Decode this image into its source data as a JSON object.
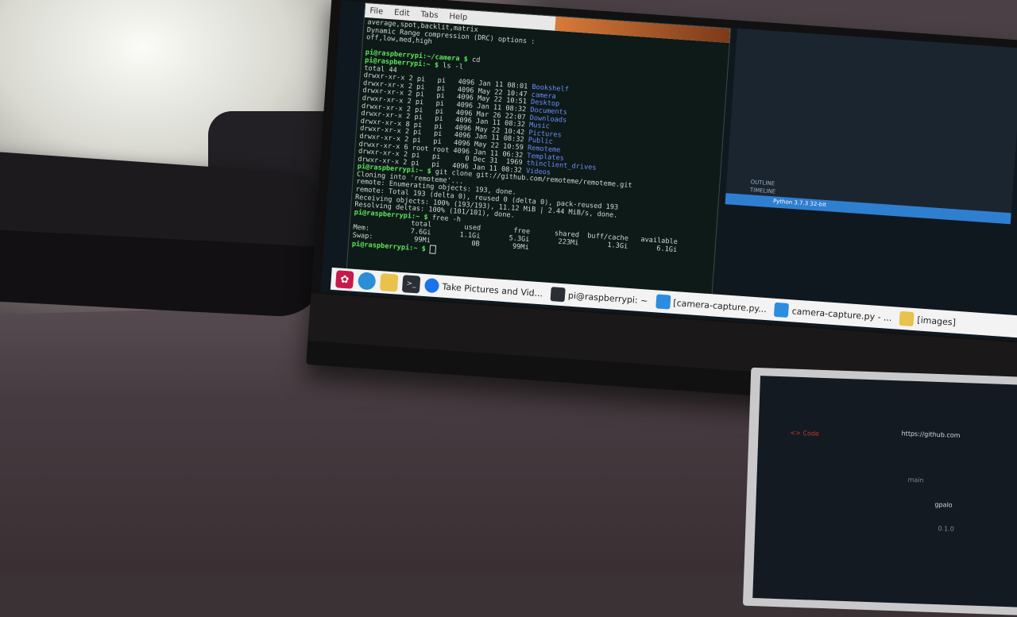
{
  "terminal": {
    "menu": [
      "File",
      "Edit",
      "Tabs",
      "Help"
    ],
    "lines": [
      {
        "t": "average,spot,backlit,matrix",
        "c": ""
      },
      {
        "t": "Dynamic Range compression (DRC) options :",
        "c": ""
      },
      {
        "t": "off,low,med,high",
        "c": ""
      },
      {
        "t": "",
        "c": ""
      },
      {
        "p": "pi@raspberrypi:~/camera $ ",
        "t": "cd",
        "c": ""
      },
      {
        "p": "pi@raspberrypi:~ $ ",
        "t": "ls -l",
        "c": ""
      },
      {
        "t": "total 44",
        "c": ""
      },
      {
        "t": "drwxr-xr-x 2 pi   pi   4096 Jan 11 08:01 ",
        "d": "Bookshelf"
      },
      {
        "t": "drwxr-xr-x 2 pi   pi   4096 May 22 10:47 ",
        "d": "camera"
      },
      {
        "t": "drwxr-xr-x 2 pi   pi   4096 May 22 10:51 ",
        "d": "Desktop"
      },
      {
        "t": "drwxr-xr-x 2 pi   pi   4096 Jan 11 08:32 ",
        "d": "Documents"
      },
      {
        "t": "drwxr-xr-x 2 pi   pi   4096 Mar 26 22:07 ",
        "d": "Downloads"
      },
      {
        "t": "drwxr-xr-x 2 pi   pi   4096 Jan 11 08:32 ",
        "d": "Music"
      },
      {
        "t": "drwxr-xr-x 8 pi   pi   4096 May 22 10:42 ",
        "d": "Pictures"
      },
      {
        "t": "drwxr-xr-x 2 pi   pi   4096 Jan 11 08:32 ",
        "d": "Public"
      },
      {
        "t": "drwxr-xr-x 2 pi   pi   4096 May 22 10:59 ",
        "d": "Remoteme"
      },
      {
        "t": "drwxr-xr-x 6 root root 4096 Jan 11 06:32 ",
        "d": "Templates"
      },
      {
        "t": "drwxr-xr-x 2 pi   pi      0 Dec 31  1969 ",
        "d": "thinclient_drives"
      },
      {
        "t": "drwxr-xr-x 2 pi   pi   4096 Jan 11 08:32 ",
        "d": "Videos"
      },
      {
        "p": "pi@raspberrypi:~ $ ",
        "t": "git clone git://github.com/remoteme/remoteme.git",
        "c": ""
      },
      {
        "t": "Cloning into 'remoteme'...",
        "c": ""
      },
      {
        "t": "remote: Enumerating objects: 193, done.",
        "c": ""
      },
      {
        "t": "remote: Total 193 (delta 0), reused 0 (delta 0), pack-reused 193",
        "c": ""
      },
      {
        "t": "Receiving objects: 100% (193/193), 11.12 MiB | 2.44 MiB/s, done.",
        "c": ""
      },
      {
        "t": "Resolving deltas: 100% (101/101), done.",
        "c": ""
      },
      {
        "p": "pi@raspberrypi:~ $ ",
        "t": "free -h",
        "c": ""
      },
      {
        "t": "              total        used        free      shared  buff/cache   available",
        "c": ""
      },
      {
        "t": "Mem:          7.6Gi       1.1Gi       5.3Gi       223Mi       1.3Gi       6.1Gi",
        "c": ""
      },
      {
        "t": "Swap:          99Mi          0B        99Mi",
        "c": ""
      },
      {
        "p": "pi@raspberrypi:~ $ ",
        "t": "",
        "c": "cursor"
      }
    ]
  },
  "vscode": {
    "outline": "OUTLINE",
    "timeline": "TIMELINE",
    "status_text": "Python 3.7.3 32-bit"
  },
  "taskbar": {
    "items": [
      {
        "icon": "chromium-icon",
        "label": "Take Pictures and Vid..."
      },
      {
        "icon": "terminal-icon",
        "label": "pi@raspberrypi: ~"
      },
      {
        "icon": "vscode-icon",
        "label": "[camera-capture.py..."
      },
      {
        "icon": "vscode-icon",
        "label": "camera-capture.py - ..."
      },
      {
        "icon": "folder-icon",
        "label": "[images]"
      }
    ]
  },
  "laptop": {
    "url": "https://github.com",
    "code_label": "<> Code",
    "branch": "main",
    "item1": "gpalo",
    "item2": "0.1.0"
  },
  "colors": {
    "prompt": "#5de35d",
    "directory": "#6b8cff",
    "taskbar": "#f3f3f3",
    "vscode_status": "#2f7fd1"
  }
}
